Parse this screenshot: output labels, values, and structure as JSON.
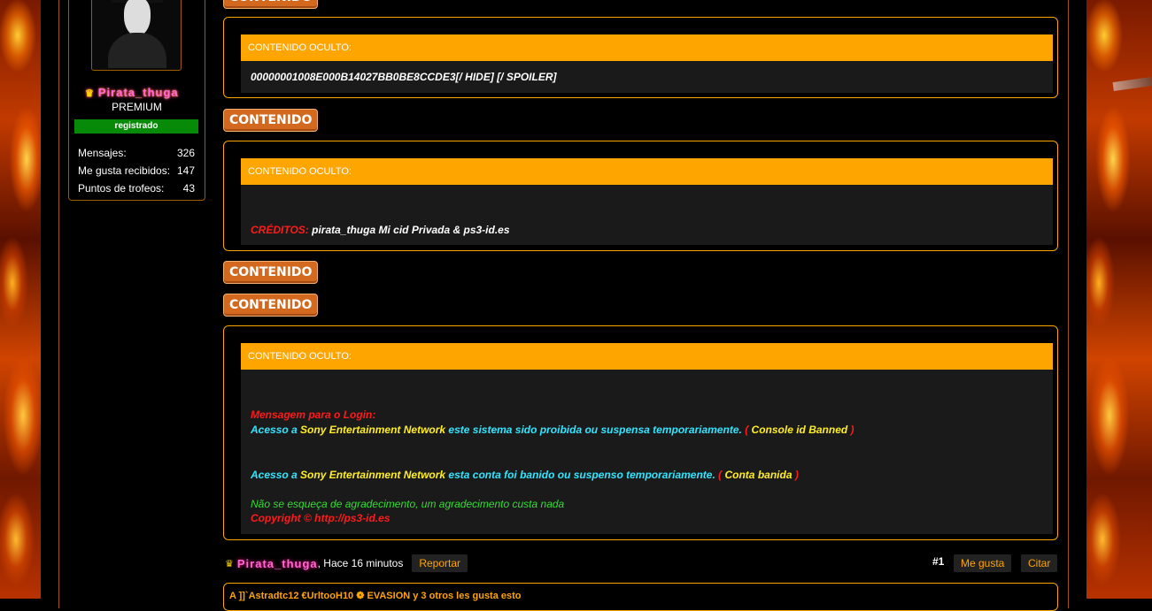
{
  "user": {
    "name": "Pirata_thuga",
    "rank": "PREMIUM",
    "status_badge": "registrado",
    "stats": [
      {
        "label": "Mensajes:",
        "value": "326"
      },
      {
        "label": "Me gusta recibidos:",
        "value": "147"
      },
      {
        "label": "Puntos de trofeos:",
        "value": "43"
      }
    ]
  },
  "buttons": {
    "contenido": "CONTENIDO"
  },
  "boxes": [
    {
      "header": "CONTENIDO OCULTO:",
      "line": "00000001008E000B14027BB0BE8CCDE3[/ HIDE] [/ SPOILER]"
    },
    {
      "header": "CONTENIDO OCULTO:",
      "credit_label": "CRÉDITOS:",
      "credit_text": " pirata_thuga Mi cid Privada & ps3-id.es"
    },
    {
      "header": "CONTENIDO OCULTO:",
      "msg_title": "Mensagem para o Login:",
      "l1a": "Acesso a ",
      "l1b": "Sony Entertainment Network",
      "l1c": " este sistema sido proibida ou suspensa temporariamente. ",
      "l1d": "( ",
      "l1e": "Console id Banned",
      "l1f": " )",
      "l2a": "Acesso a ",
      "l2b": "Sony Entertainment Network",
      "l2c": " esta conta foi banido ou suspenso temporariamente. ",
      "l2d": "( ",
      "l2e": "Conta banida",
      "l2f": " )",
      "thanks": "Não se esqueça de agradecimento, um agradecimento custa nada",
      "copyright": "Copyright © http://ps3-id.es"
    }
  ],
  "post": {
    "author": "Pirata_thuga",
    "time": ", Hace 16 minutos",
    "report": "Reportar",
    "number": "#1",
    "like": "Me gusta",
    "quote": "Citar"
  },
  "likes": {
    "text": "A  ]]`Astradtc12  €UrltooH10 ❁ EVASION y 3 otros les gusta esto"
  }
}
